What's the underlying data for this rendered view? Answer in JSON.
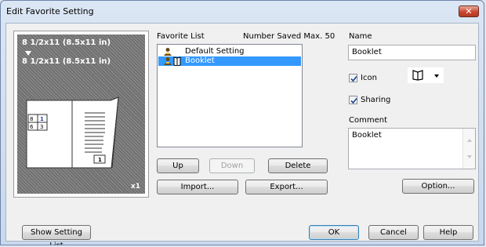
{
  "window": {
    "title": "Edit Favorite Setting",
    "close_glyph": "✕"
  },
  "preview": {
    "original_size": "8 1/2x11 (8.5x11 in)",
    "output_size": "8 1/2x11 (8.5x11 in)",
    "copies": "x1",
    "page_numbers": [
      "8",
      "1",
      "6",
      "3",
      "1"
    ]
  },
  "favorites": {
    "list_label": "Favorite List",
    "number_saved_label": "Number Saved Max. 50",
    "items": [
      {
        "label": "Default Setting",
        "icon": "user-icon"
      },
      {
        "label": "Booklet",
        "icon": "booklet-icon"
      }
    ],
    "buttons": {
      "up": "Up",
      "down": "Down",
      "delete": "Delete",
      "import": "Import...",
      "export": "Export..."
    }
  },
  "details": {
    "name_label": "Name",
    "name_value": "Booklet",
    "icon_label": "Icon",
    "icon_checked": true,
    "sharing_label": "Sharing",
    "sharing_checked": true,
    "comment_label": "Comment",
    "comment_value": "Booklet",
    "option_button": "Option..."
  },
  "footer": {
    "show_setting_list": "Show Setting List",
    "ok": "OK",
    "cancel": "Cancel",
    "help": "Help"
  }
}
